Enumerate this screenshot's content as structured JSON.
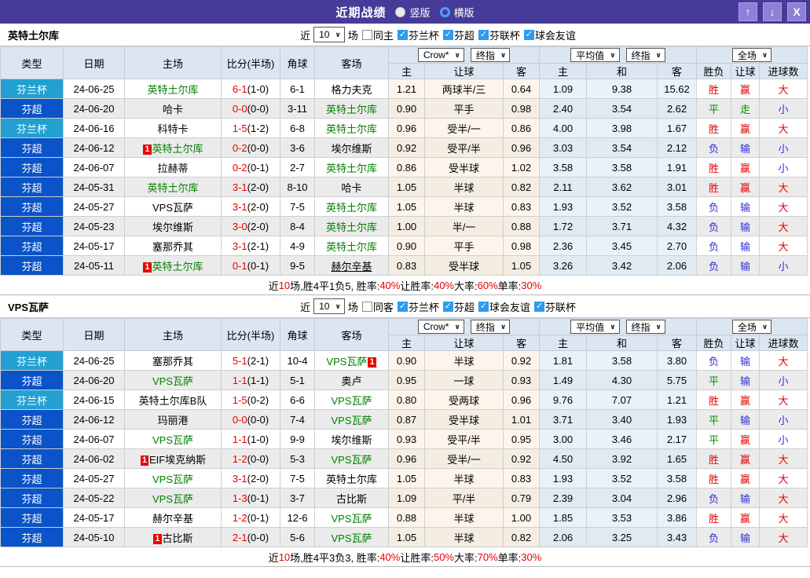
{
  "badge_text": "1",
  "colors": {
    "titlebar_bg": "#473b99",
    "cup_bg": "#22a0d2",
    "super_bg": "#0a53c8",
    "win": "#e60000",
    "draw": "#009000",
    "lose": "#3030cf",
    "team_link_green": "#008000",
    "checkbox_blue": "#2d9bf0",
    "crow_col_bg": "#fdf5ec",
    "avg_col_bg": "#e7f2f9"
  },
  "titlebar": {
    "title": "近期战绩",
    "radios": [
      {
        "label": "竖版",
        "selected": true
      },
      {
        "label": "横版",
        "selected": false
      }
    ],
    "buttons": [
      {
        "name": "up",
        "glyph": "↑"
      },
      {
        "name": "down",
        "glyph": "↓"
      },
      {
        "name": "close",
        "glyph": "X"
      }
    ]
  },
  "header": {
    "cols": [
      "类型",
      "日期",
      "主场",
      "比分(半场)",
      "角球",
      "客场"
    ],
    "odds_selects": [
      "Crow*",
      "终指"
    ],
    "avg_selects": [
      "平均值",
      "终指"
    ],
    "full_selects": [
      "全场"
    ],
    "sub": [
      "主",
      "让球",
      "客",
      "主",
      "和",
      "客",
      "胜负",
      "让球",
      "进球数"
    ]
  },
  "sections": [
    {
      "team": "英特土尔库",
      "near": {
        "prefix": "近",
        "value": "10",
        "suffix": "场"
      },
      "same": {
        "label": "同主",
        "checked": false
      },
      "leagues": [
        {
          "label": "芬兰杯",
          "checked": true
        },
        {
          "label": "芬超",
          "checked": true
        },
        {
          "label": "芬联杯",
          "checked": true
        },
        {
          "label": "球会友谊",
          "checked": true
        }
      ],
      "rows": [
        {
          "type": "芬兰杯",
          "league": "cup",
          "date": "24-06-25",
          "home": {
            "name": "英特土尔库",
            "green": true
          },
          "ft": "6-1",
          "ht": "(1-0)",
          "corner": "6-1",
          "away": {
            "name": "格力夫克"
          },
          "odds": [
            "1.21",
            "两球半/三",
            "0.64"
          ],
          "avg": [
            "1.09",
            "9.38",
            "15.62"
          ],
          "results": [
            {
              "t": "胜",
              "c": "red"
            },
            {
              "t": "赢",
              "c": "red"
            },
            {
              "t": "大",
              "c": "red"
            }
          ]
        },
        {
          "type": "芬超",
          "league": "super",
          "date": "24-06-20",
          "home": {
            "name": "哈卡"
          },
          "ft": "0-0",
          "ht": "(0-0)",
          "corner": "3-11",
          "away": {
            "name": "英特土尔库",
            "green": true
          },
          "odds": [
            "0.90",
            "平手",
            "0.98"
          ],
          "avg": [
            "2.40",
            "3.54",
            "2.62"
          ],
          "results": [
            {
              "t": "平",
              "c": "green"
            },
            {
              "t": "走",
              "c": "green"
            },
            {
              "t": "小",
              "c": "blue"
            }
          ]
        },
        {
          "type": "芬兰杯",
          "league": "cup",
          "date": "24-06-16",
          "home": {
            "name": "科特卡"
          },
          "ft": "1-5",
          "ht": "(1-2)",
          "corner": "6-8",
          "away": {
            "name": "英特土尔库",
            "green": true
          },
          "odds": [
            "0.96",
            "受半/一",
            "0.86"
          ],
          "avg": [
            "4.00",
            "3.98",
            "1.67"
          ],
          "results": [
            {
              "t": "胜",
              "c": "red"
            },
            {
              "t": "赢",
              "c": "red"
            },
            {
              "t": "大",
              "c": "red"
            }
          ]
        },
        {
          "type": "芬超",
          "league": "super",
          "date": "24-06-12",
          "home": {
            "name": "英特土尔库",
            "green": true,
            "badge": "pre"
          },
          "ft": "0-2",
          "ht": "(0-0)",
          "corner": "3-6",
          "away": {
            "name": "埃尔维斯"
          },
          "odds": [
            "0.92",
            "受平/半",
            "0.96"
          ],
          "avg": [
            "3.03",
            "3.54",
            "2.12"
          ],
          "results": [
            {
              "t": "负",
              "c": "blue"
            },
            {
              "t": "输",
              "c": "blue"
            },
            {
              "t": "小",
              "c": "blue"
            }
          ]
        },
        {
          "type": "芬超",
          "league": "super",
          "date": "24-06-07",
          "home": {
            "name": "拉赫蒂"
          },
          "ft": "0-2",
          "ht": "(0-1)",
          "corner": "2-7",
          "away": {
            "name": "英特土尔库",
            "green": true
          },
          "odds": [
            "0.86",
            "受半球",
            "1.02"
          ],
          "avg": [
            "3.58",
            "3.58",
            "1.91"
          ],
          "results": [
            {
              "t": "胜",
              "c": "red"
            },
            {
              "t": "赢",
              "c": "red"
            },
            {
              "t": "小",
              "c": "blue"
            }
          ]
        },
        {
          "type": "芬超",
          "league": "super",
          "date": "24-05-31",
          "home": {
            "name": "英特土尔库",
            "green": true
          },
          "ft": "3-1",
          "ht": "(2-0)",
          "corner": "8-10",
          "away": {
            "name": "哈卡"
          },
          "odds": [
            "1.05",
            "半球",
            "0.82"
          ],
          "avg": [
            "2.11",
            "3.62",
            "3.01"
          ],
          "results": [
            {
              "t": "胜",
              "c": "red"
            },
            {
              "t": "赢",
              "c": "red"
            },
            {
              "t": "大",
              "c": "red"
            }
          ]
        },
        {
          "type": "芬超",
          "league": "super",
          "date": "24-05-27",
          "home": {
            "name": "VPS瓦萨"
          },
          "ft": "3-1",
          "ht": "(2-0)",
          "corner": "7-5",
          "away": {
            "name": "英特土尔库",
            "green": true
          },
          "odds": [
            "1.05",
            "半球",
            "0.83"
          ],
          "avg": [
            "1.93",
            "3.52",
            "3.58"
          ],
          "results": [
            {
              "t": "负",
              "c": "blue"
            },
            {
              "t": "输",
              "c": "blue"
            },
            {
              "t": "大",
              "c": "red"
            }
          ]
        },
        {
          "type": "芬超",
          "league": "super",
          "date": "24-05-23",
          "home": {
            "name": "埃尔维斯"
          },
          "ft": "3-0",
          "ht": "(2-0)",
          "corner": "8-4",
          "away": {
            "name": "英特土尔库",
            "green": true
          },
          "odds": [
            "1.00",
            "半/一",
            "0.88"
          ],
          "avg": [
            "1.72",
            "3.71",
            "4.32"
          ],
          "results": [
            {
              "t": "负",
              "c": "blue"
            },
            {
              "t": "输",
              "c": "blue"
            },
            {
              "t": "大",
              "c": "red"
            }
          ]
        },
        {
          "type": "芬超",
          "league": "super",
          "date": "24-05-17",
          "home": {
            "name": "塞那乔其"
          },
          "ft": "3-1",
          "ht": "(2-1)",
          "corner": "4-9",
          "away": {
            "name": "英特土尔库",
            "green": true
          },
          "odds": [
            "0.90",
            "平手",
            "0.98"
          ],
          "avg": [
            "2.36",
            "3.45",
            "2.70"
          ],
          "results": [
            {
              "t": "负",
              "c": "blue"
            },
            {
              "t": "输",
              "c": "blue"
            },
            {
              "t": "大",
              "c": "red"
            }
          ]
        },
        {
          "type": "芬超",
          "league": "super",
          "date": "24-05-11",
          "home": {
            "name": "英特土尔库",
            "green": true,
            "badge": "pre"
          },
          "ft": "0-1",
          "ht": "(0-1)",
          "corner": "9-5",
          "away": {
            "name": "赫尔辛基",
            "underline": true
          },
          "odds": [
            "0.83",
            "受半球",
            "1.05"
          ],
          "avg": [
            "3.26",
            "3.42",
            "2.06"
          ],
          "results": [
            {
              "t": "负",
              "c": "blue"
            },
            {
              "t": "输",
              "c": "blue"
            },
            {
              "t": "小",
              "c": "blue"
            }
          ]
        }
      ],
      "footer": [
        {
          "t": "近"
        },
        {
          "t": "10",
          "red": true
        },
        {
          "t": "场,胜4平1负5, 胜率:"
        },
        {
          "t": "40%",
          "red": true
        },
        {
          "t": " 让胜率:"
        },
        {
          "t": "40%",
          "red": true
        },
        {
          "t": " 大率:"
        },
        {
          "t": "60%",
          "red": true
        },
        {
          "t": " 单率:"
        },
        {
          "t": "30%",
          "red": true
        }
      ]
    },
    {
      "team": "VPS瓦萨",
      "near": {
        "prefix": "近",
        "value": "10",
        "suffix": "场"
      },
      "same": {
        "label": "同客",
        "checked": false
      },
      "leagues": [
        {
          "label": "芬兰杯",
          "checked": true
        },
        {
          "label": "芬超",
          "checked": true
        },
        {
          "label": "球会友谊",
          "checked": true
        },
        {
          "label": "芬联杯",
          "checked": true
        }
      ],
      "rows": [
        {
          "type": "芬兰杯",
          "league": "cup",
          "date": "24-06-25",
          "home": {
            "name": "塞那乔其"
          },
          "ft": "5-1",
          "ht": "(2-1)",
          "corner": "10-4",
          "away": {
            "name": "VPS瓦萨",
            "green": true,
            "badge": "post"
          },
          "odds": [
            "0.90",
            "半球",
            "0.92"
          ],
          "avg": [
            "1.81",
            "3.58",
            "3.80"
          ],
          "results": [
            {
              "t": "负",
              "c": "blue"
            },
            {
              "t": "输",
              "c": "blue"
            },
            {
              "t": "大",
              "c": "red"
            }
          ]
        },
        {
          "type": "芬超",
          "league": "super",
          "date": "24-06-20",
          "home": {
            "name": "VPS瓦萨",
            "green": true
          },
          "ft": "1-1",
          "ht": "(1-1)",
          "corner": "5-1",
          "away": {
            "name": "奥卢"
          },
          "odds": [
            "0.95",
            "一球",
            "0.93"
          ],
          "avg": [
            "1.49",
            "4.30",
            "5.75"
          ],
          "results": [
            {
              "t": "平",
              "c": "green"
            },
            {
              "t": "输",
              "c": "blue"
            },
            {
              "t": "小",
              "c": "blue"
            }
          ]
        },
        {
          "type": "芬兰杯",
          "league": "cup",
          "date": "24-06-15",
          "home": {
            "name": "英特土尔库B队"
          },
          "ft": "1-5",
          "ht": "(0-2)",
          "corner": "6-6",
          "away": {
            "name": "VPS瓦萨",
            "green": true
          },
          "odds": [
            "0.80",
            "受两球",
            "0.96"
          ],
          "avg": [
            "9.76",
            "7.07",
            "1.21"
          ],
          "results": [
            {
              "t": "胜",
              "c": "red"
            },
            {
              "t": "赢",
              "c": "red"
            },
            {
              "t": "大",
              "c": "red"
            }
          ]
        },
        {
          "type": "芬超",
          "league": "super",
          "date": "24-06-12",
          "home": {
            "name": "玛丽港"
          },
          "ft": "0-0",
          "ht": "(0-0)",
          "corner": "7-4",
          "away": {
            "name": "VPS瓦萨",
            "green": true
          },
          "odds": [
            "0.87",
            "受半球",
            "1.01"
          ],
          "avg": [
            "3.71",
            "3.40",
            "1.93"
          ],
          "results": [
            {
              "t": "平",
              "c": "green"
            },
            {
              "t": "输",
              "c": "blue"
            },
            {
              "t": "小",
              "c": "blue"
            }
          ]
        },
        {
          "type": "芬超",
          "league": "super",
          "date": "24-06-07",
          "home": {
            "name": "VPS瓦萨",
            "green": true
          },
          "ft": "1-1",
          "ht": "(1-0)",
          "corner": "9-9",
          "away": {
            "name": "埃尔维斯"
          },
          "odds": [
            "0.93",
            "受平/半",
            "0.95"
          ],
          "avg": [
            "3.00",
            "3.46",
            "2.17"
          ],
          "results": [
            {
              "t": "平",
              "c": "green"
            },
            {
              "t": "赢",
              "c": "red"
            },
            {
              "t": "小",
              "c": "blue"
            }
          ]
        },
        {
          "type": "芬超",
          "league": "super",
          "date": "24-06-02",
          "home": {
            "name": "EIF埃克纳斯",
            "badge": "pre"
          },
          "ft": "1-2",
          "ht": "(0-0)",
          "corner": "5-3",
          "away": {
            "name": "VPS瓦萨",
            "green": true
          },
          "odds": [
            "0.96",
            "受半/一",
            "0.92"
          ],
          "avg": [
            "4.50",
            "3.92",
            "1.65"
          ],
          "results": [
            {
              "t": "胜",
              "c": "red"
            },
            {
              "t": "赢",
              "c": "red"
            },
            {
              "t": "大",
              "c": "red"
            }
          ]
        },
        {
          "type": "芬超",
          "league": "super",
          "date": "24-05-27",
          "home": {
            "name": "VPS瓦萨",
            "green": true
          },
          "ft": "3-1",
          "ht": "(2-0)",
          "corner": "7-5",
          "away": {
            "name": "英特土尔库"
          },
          "odds": [
            "1.05",
            "半球",
            "0.83"
          ],
          "avg": [
            "1.93",
            "3.52",
            "3.58"
          ],
          "results": [
            {
              "t": "胜",
              "c": "red"
            },
            {
              "t": "赢",
              "c": "red"
            },
            {
              "t": "大",
              "c": "red"
            }
          ]
        },
        {
          "type": "芬超",
          "league": "super",
          "date": "24-05-22",
          "home": {
            "name": "VPS瓦萨",
            "green": true
          },
          "ft": "1-3",
          "ht": "(0-1)",
          "corner": "3-7",
          "away": {
            "name": "古比斯"
          },
          "odds": [
            "1.09",
            "平/半",
            "0.79"
          ],
          "avg": [
            "2.39",
            "3.04",
            "2.96"
          ],
          "results": [
            {
              "t": "负",
              "c": "blue"
            },
            {
              "t": "输",
              "c": "blue"
            },
            {
              "t": "大",
              "c": "red"
            }
          ]
        },
        {
          "type": "芬超",
          "league": "super",
          "date": "24-05-17",
          "home": {
            "name": "赫尔辛基"
          },
          "ft": "1-2",
          "ht": "(0-1)",
          "corner": "12-6",
          "away": {
            "name": "VPS瓦萨",
            "green": true
          },
          "odds": [
            "0.88",
            "半球",
            "1.00"
          ],
          "avg": [
            "1.85",
            "3.53",
            "3.86"
          ],
          "results": [
            {
              "t": "胜",
              "c": "red"
            },
            {
              "t": "赢",
              "c": "red"
            },
            {
              "t": "大",
              "c": "red"
            }
          ]
        },
        {
          "type": "芬超",
          "league": "super",
          "date": "24-05-10",
          "home": {
            "name": "古比斯",
            "badge": "pre"
          },
          "ft": "2-1",
          "ht": "(0-0)",
          "corner": "5-6",
          "away": {
            "name": "VPS瓦萨",
            "green": true
          },
          "odds": [
            "1.05",
            "半球",
            "0.82"
          ],
          "avg": [
            "2.06",
            "3.25",
            "3.43"
          ],
          "results": [
            {
              "t": "负",
              "c": "blue"
            },
            {
              "t": "输",
              "c": "blue"
            },
            {
              "t": "大",
              "c": "red"
            }
          ]
        }
      ],
      "footer": [
        {
          "t": "近"
        },
        {
          "t": "10",
          "red": true
        },
        {
          "t": "场,胜4平3负3, 胜率:"
        },
        {
          "t": "40%",
          "red": true
        },
        {
          "t": " 让胜率:"
        },
        {
          "t": "50%",
          "red": true
        },
        {
          "t": " 大率:"
        },
        {
          "t": "70%",
          "red": true
        },
        {
          "t": " 单率:"
        },
        {
          "t": "30%",
          "red": true
        }
      ]
    }
  ]
}
